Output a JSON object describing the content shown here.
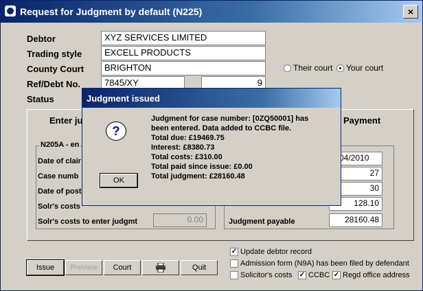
{
  "window": {
    "title": "Request for Judgment by default (N225)",
    "close_glyph": "×"
  },
  "form": {
    "debtor_label": "Debtor",
    "debtor_value": "XYZ SERVICES LIMITED",
    "trading_label": "Trading style",
    "trading_value": "EXCELL PRODUCTS",
    "court_label": "County Court",
    "court_value": "BRIGHTON",
    "ref_label": "Ref/Debt No.",
    "ref_value": "7845/XY",
    "debt_no_value": "9",
    "status_label": "Status",
    "radio_their": "Their court",
    "radio_your": "Your court",
    "selected_radio": "your"
  },
  "tabs": {
    "enter": "Enter ju",
    "payment": "Payment"
  },
  "panel": {
    "group_title": "N205A - en",
    "rows": [
      "Date of clair",
      "Case numb",
      "Date of post",
      "Solr's costs"
    ],
    "solr_enter_label": "Solr's costs to enter judgmt",
    "solr_enter_value": "0.00",
    "right_values": [
      "1/04/2010",
      "27",
      "30",
      "128.10"
    ],
    "judgment_payable_label": "Judgment payable",
    "judgment_payable_value": "28160.48"
  },
  "buttons": {
    "issue": "Issue",
    "preview": "Preview",
    "court": "Court",
    "print_icon": "printer-icon",
    "quit": "Quit"
  },
  "checks": {
    "update_debtor": "Update debtor record",
    "update_debtor_checked": true,
    "admission": "Admission form (N9A) has been filed by defendant",
    "admission_checked": false,
    "solicitor": "Solicitor's costs",
    "solicitor_checked": false,
    "ccbc": "CCBC",
    "ccbc_checked": true,
    "regd": "Regd office address",
    "regd_checked": true
  },
  "dialog": {
    "title": "Judgment issued",
    "icon": "question-icon",
    "lines": [
      "Judgment for case number: [0ZQ50001] has",
      "been entered. Data added to CCBC file.",
      "Total due: £19469.75",
      "Interest: £8380.73",
      "Total costs: £310.00",
      "Total paid since issue: £0.00",
      "Total judgment: £28160.48"
    ],
    "ok_label": "OK"
  }
}
